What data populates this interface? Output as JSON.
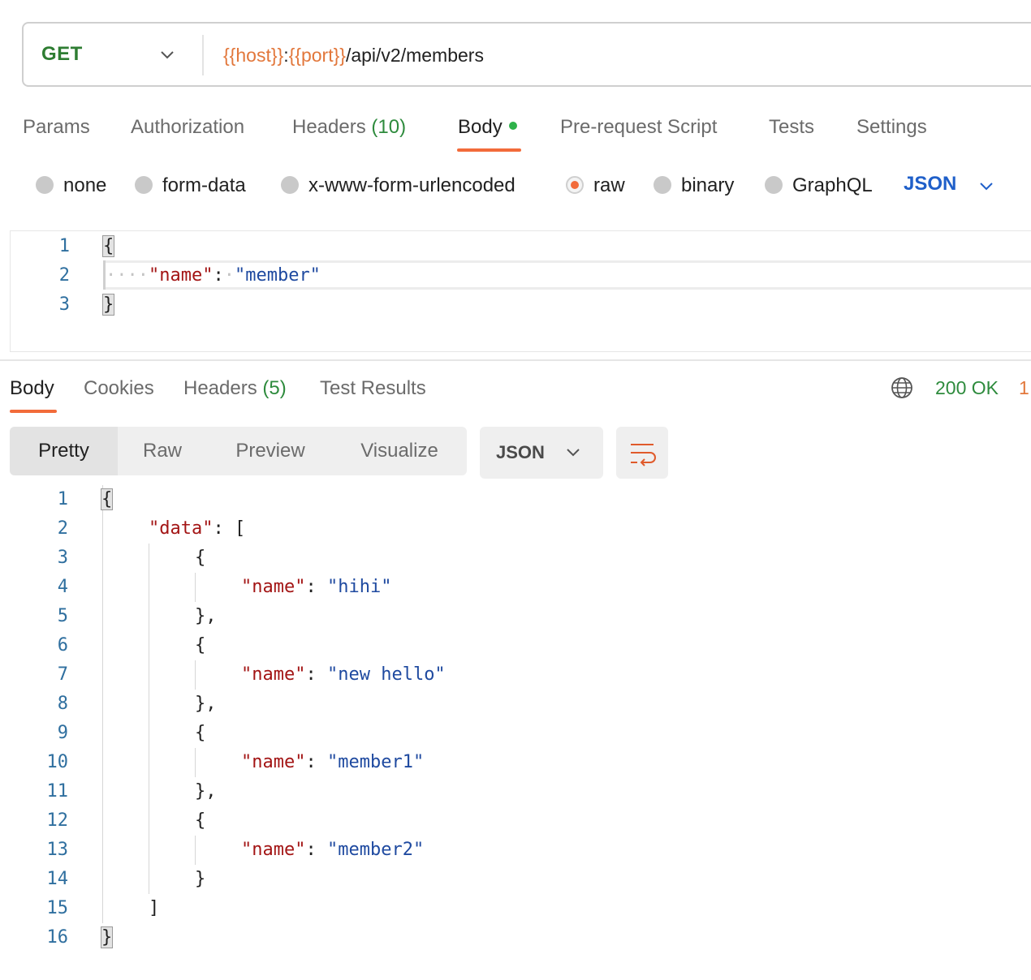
{
  "request": {
    "method": "GET",
    "url_vars": [
      "{{host}}",
      "{{port}}"
    ],
    "url_sep": ":",
    "url_path": "/api/v2/members"
  },
  "request_tabs": {
    "params": "Params",
    "authorization": "Authorization",
    "headers": "Headers",
    "headers_count": "(10)",
    "body": "Body",
    "prerequest": "Pre-request Script",
    "tests": "Tests",
    "settings": "Settings"
  },
  "body_types": {
    "none": "none",
    "form_data": "form-data",
    "urlencoded": "x-www-form-urlencoded",
    "raw": "raw",
    "binary": "binary",
    "graphql": "GraphQL",
    "selected": "raw",
    "raw_language": "JSON"
  },
  "request_body": {
    "line_numbers": [
      "1",
      "2",
      "3"
    ],
    "open_brace": "{",
    "key": "\"name\"",
    "colon": ":",
    "value": "\"member\"",
    "close_brace": "}"
  },
  "response_tabs": {
    "body": "Body",
    "cookies": "Cookies",
    "headers": "Headers",
    "headers_count": "(5)",
    "test_results": "Test Results"
  },
  "response_status": {
    "status": "200 OK",
    "time_partial": "1"
  },
  "response_views": {
    "pretty": "Pretty",
    "raw": "Raw",
    "preview": "Preview",
    "visualize": "Visualize",
    "format": "JSON"
  },
  "response_body": {
    "line_numbers": [
      "1",
      "2",
      "3",
      "4",
      "5",
      "6",
      "7",
      "8",
      "9",
      "10",
      "11",
      "12",
      "13",
      "14",
      "15",
      "16"
    ],
    "data_key": "\"data\"",
    "name_key": "\"name\"",
    "values": [
      "\"hihi\"",
      "\"new hello\"",
      "\"member1\"",
      "\"member2\""
    ]
  },
  "icons": {
    "method_dropdown": "chevron-down-icon",
    "globe": "globe-icon",
    "wrap": "word-wrap-icon"
  },
  "colors": {
    "accent": "#f26b3a",
    "method": "#2e7d32",
    "variable": "#e2773b",
    "json_key": "#a31515",
    "json_string": "#1f4aa0",
    "line_number": "#2f6f9f",
    "status_ok": "#2e8b3d",
    "link_blue": "#1f5fc9"
  }
}
